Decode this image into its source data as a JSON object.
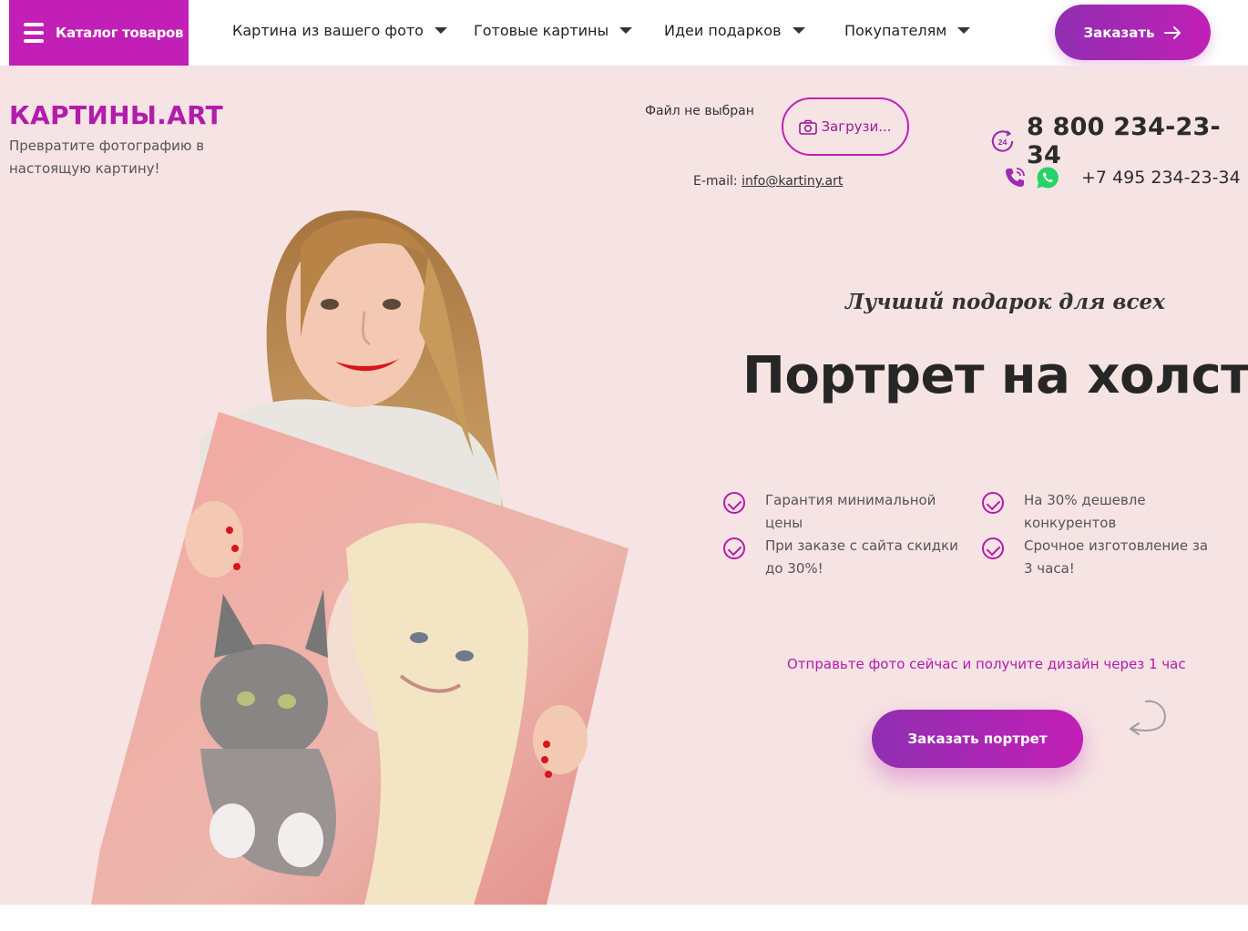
{
  "nav": {
    "catalog_label": "Каталог товаров",
    "items": [
      {
        "label": "Картина из вашего фото"
      },
      {
        "label": "Готовые картины"
      },
      {
        "label": "Идеи подарков"
      },
      {
        "label": "Покупателям"
      }
    ],
    "order_label": "Заказать"
  },
  "header": {
    "brand": "КАРТИНЫ.ART",
    "tagline": "Превратите фотографию в настоящую картину!",
    "file_status": "Файл не выбран",
    "upload_label": "Загрузи...",
    "email_label": "E-mail:",
    "email": "info@kartiny.art",
    "phone_main": "8 800 234-23-34",
    "phone_secondary": "+7 495 234-23-34",
    "badge_24": "24"
  },
  "hero": {
    "subtitle": "Лучший подарок для всех",
    "headline": "Портрет на холсте",
    "features": [
      {
        "text": "Гарантия минимальной цены"
      },
      {
        "text": "На 30% дешевле конкурентов"
      },
      {
        "text": "При заказе с сайта скидки до 30%!"
      },
      {
        "text": "Срочное изготовление за 3 часа!"
      }
    ],
    "cta_note": "Отправьте фото сейчас и получите дизайн через 1 час",
    "cta_label": "Заказать портрет"
  },
  "colors": {
    "accent": "#c21fb6",
    "accent_dark": "#8f2fb1",
    "hero_bg": "#f6e3e3",
    "whatsapp": "#25d366"
  },
  "icons": [
    "menu-icon",
    "chevron-down-icon",
    "arrow-right-icon",
    "camera-icon",
    "clock-24-icon",
    "phone-icon",
    "whatsapp-icon",
    "check-circle-icon",
    "curved-arrow-icon"
  ]
}
